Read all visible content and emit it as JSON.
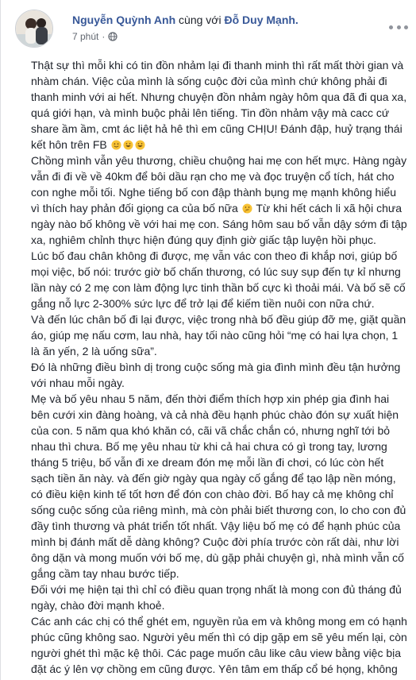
{
  "post": {
    "author": "Nguyễn Quỳnh Anh",
    "with_text": "cùng với",
    "tagged": "Đỗ Duy Mạnh.",
    "time": "7 phút",
    "time_sep": "·",
    "privacy_icon": "globe-icon",
    "more_icon": "more-options-icon"
  },
  "paragraphs": [
    {
      "text": "Thật sự thì mỗi khi có tin đồn nhảm lại đi thanh minh thì rất mất thời gian và nhàm chán. Việc của mình là sống cuộc đời của mình chứ không phải đi thanh minh với ai hết. Nhưng chuyện đồn nhảm ngày hôm qua đã đi qua xa, quá giới hạn, và mình buộc phải lên tiếng. Tin đồn nhảm vậy mà cacc cứ share ầm ầm, cmt ác liệt hả hê thì em cũng CHỊU! Đánh đập, huỷ trạng thái kết hôn trên FB",
      "emoji_after": [
        "smile",
        "grin",
        "grin"
      ]
    },
    {
      "text": "Chồng mình vẫn yêu thương, chiều chuộng hai mẹ con hết mực. Hàng ngày vẫn đi đi về về 40km để bôi dầu rạn cho mẹ và đọc truyện cổ tích, hát cho con nghe mỗi tối. Nghe tiếng bố con đập thành bụng mẹ mạnh không hiểu vì thích hay phản đối giọng ca của bố nữa",
      "emoji_after": [
        "thinking"
      ],
      "text_after": "Từ khi hết cách li xã hội chưa ngày nào bố không về với hai mẹ con. Sáng hôm sau bố vẫn dậy sớm đi tập xa, nghiêm chỉnh thực hiện đúng quy định giờ giấc tập luyện hồi phục."
    },
    {
      "text": "Lúc bố đau chân không đi được, mẹ vẫn vác con theo đi khắp nơi, giúp bố mọi việc, bố nói: trước giờ bố chấn thương, có lúc suy sụp đến tự kỉ nhưng lần này có 2 mẹ con làm động lực tinh thần bố cực kì thoải mái. Và bố sẽ cố gắng nỗ lực 2-300% sức lực để trở lại để kiếm tiền nuôi con nữa chứ."
    },
    {
      "text": "Và đến lúc chân bố đi lại được, việc trong nhà bố đều giúp đỡ mẹ, giặt quần áo, giúp mẹ nấu cơm, lau nhà, hay tối nào cũng hỏi “mẹ có hai lựa chọn, 1 là ăn yến, 2 là uống sữa”."
    },
    {
      "text": "Đó là những điều bình dị trong cuộc sống mà gia đình mình đều tận hưởng với nhau mỗi ngày."
    },
    {
      "text": "Mẹ và bố yêu nhau 5 năm, đến thời điểm thích hợp xin phép gia đình hai bên cưới xin đàng hoàng, và cả nhà đều hạnh phúc chào đón sự xuất hiện của con. 5 năm qua khó khăn có, cãi vã chắc chắn có, nhưng nghĩ tới bỏ nhau thì chưa. Bố mẹ yêu nhau từ khi cả hai chưa có gì trong tay, lương tháng 5 triệu, bố vẫn đi xe dream đón mẹ mỗi lần đi chơi, có lúc còn hết sạch tiền ăn này. và đến giờ ngày qua ngày cố gắng để tạo lập nền móng, có điều kiện kinh tế tốt hơn để đón con chào đời. Bố hay cả mẹ không chỉ sống cuộc sống của riêng mình, mà còn phải biết thương con, lo cho con đủ đầy tình thương và phát triển tốt nhất. Vậy liệu bố mẹ có để hạnh phúc của mình bị đánh mất dễ dàng không? Cuộc đời phía trước còn rất dài, như lời ông dặn và mong muốn với bố mẹ, dù gặp phải chuyện gì, nhà mình vẫn cố gắng cầm tay nhau bước tiếp."
    },
    {
      "text": "Đối với mẹ hiện tại thì chỉ có điều quan trọng nhất là mong con đủ tháng đủ ngày, chào đời mạnh khoẻ."
    },
    {
      "text": "Các anh các chị có thể ghét em, nguyền rủa em và không mong em có hạnh phúc cũng không sao. Người yêu mến thì có dịp gặp em sẽ yêu mến lại, còn người ghét thì mặc kệ thôi. Các page muốn câu like câu view bằng việc bịa đặt ác ý lên vợ chồng em cũng được. Yên tâm em thấp cổ bé họng, không có khả năng đi gỡ bài, không có thời gian đi kiện đâu. Nhưng sống và làm việc có đức thì mới bền! Đừng hả hê khi thấy gia đình hàng xóm có chuyện,"
    }
  ]
}
